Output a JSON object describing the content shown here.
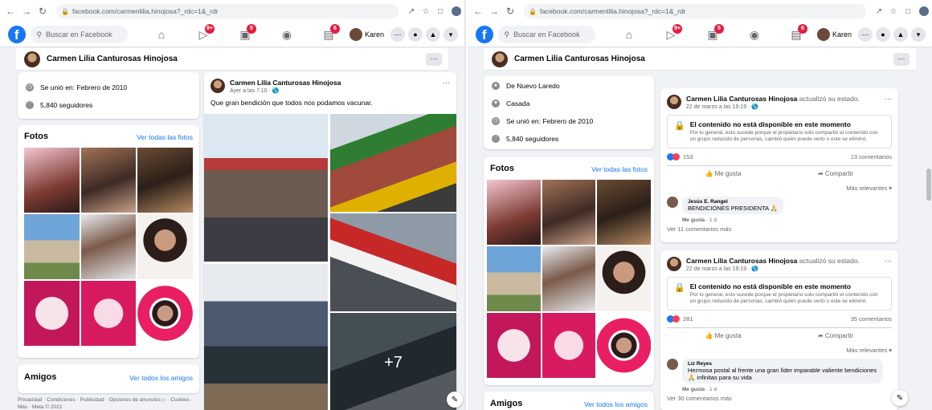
{
  "browser": {
    "url_left": "facebook.com/carmenlilia.hinojosa?_rdc=1&_rdr",
    "url_right": "facebook.com/carmenlilia.hinojosa?_rdc=1&_rdr"
  },
  "fb": {
    "search_placeholder": "Buscar en Facebook",
    "badges": [
      "9+",
      "5",
      "6"
    ],
    "user_name": "Karen"
  },
  "profile": {
    "name": "Carmen Lilia Canturosas Hinojosa",
    "more": "···"
  },
  "left": {
    "info": {
      "joined": "Se unió en: Febrero de 2010",
      "followers": "5,840 seguidores"
    },
    "photos": {
      "title": "Fotos",
      "link": "Ver todas las fotos"
    },
    "friends": {
      "title": "Amigos",
      "link": "Ver todos los amigos"
    },
    "footer": "Privacidad · Condiciones · Publicidad · Opciones de anuncios ▷ · Cookies · Más · Meta © 2022",
    "post": {
      "author": "Carmen Lilia Canturosas Hinojosa",
      "time": "Ayer a las 7:10 · 🌎",
      "text": "Que gran bendición que todos nos podamos vacunar.",
      "more_photos": "+7"
    }
  },
  "right": {
    "info": {
      "city": "De Nuevo Laredo",
      "status": "Casada",
      "joined": "Se unió en: Febrero de 2010",
      "followers": "5,840 seguidores"
    },
    "photos": {
      "title": "Fotos",
      "link": "Ver todas las fotos"
    },
    "friends": {
      "title": "Amigos",
      "link": "Ver todos los amigos"
    },
    "posts": [
      {
        "author": "Carmen Lilia Canturosas Hinojosa",
        "action": "actualizó su estado.",
        "time": "22 de marzo a las 19:19 · 🌎",
        "unavailable_title": "El contenido no está disponible en este momento",
        "unavailable_body": "Por lo general, esto sucede porque el propietario solo compartió el contenido con un grupo reducido de personas, cambió quién puede verlo o este se eliminó.",
        "reactions": "153",
        "comments": "13 comentarios",
        "like": "Me gusta",
        "share": "Compartir",
        "relevance": "Más relevantes ▾",
        "comment_author": "Jesús E. Rangel",
        "comment_text": "BENDICIONES PRESIDENTA 🙏",
        "comment_like": "Me gusta",
        "comment_age": "1 d",
        "view_more": "Ver 11 comentarios más"
      },
      {
        "author": "Carmen Lilia Canturosas Hinojosa",
        "action": "actualizó su estado.",
        "time": "22 de marzo a las 19:19 · 🌎",
        "unavailable_title": "El contenido no está disponible en este momento",
        "unavailable_body": "Por lo general, esto sucede porque el propietario solo compartió el contenido con un grupo reducido de personas, cambió quién puede verlo o este se eliminó.",
        "reactions": "281",
        "comments": "35 comentarios",
        "like": "Me gusta",
        "share": "Compartir",
        "relevance": "Más relevantes ▾",
        "comment_author": "Liz Reyes",
        "comment_text": "Hermosa postal al frente una gran líder imparable valiente bendiciones 🙏 infinitas para su vida",
        "comment_like": "Me gusta",
        "comment_age": "1 d",
        "view_more": "Ver 30 comentarios más"
      }
    ]
  },
  "colors": {
    "fb_blue": "#1877f2",
    "badge_red": "#e41e3f",
    "bg": "#f0f2f5"
  }
}
